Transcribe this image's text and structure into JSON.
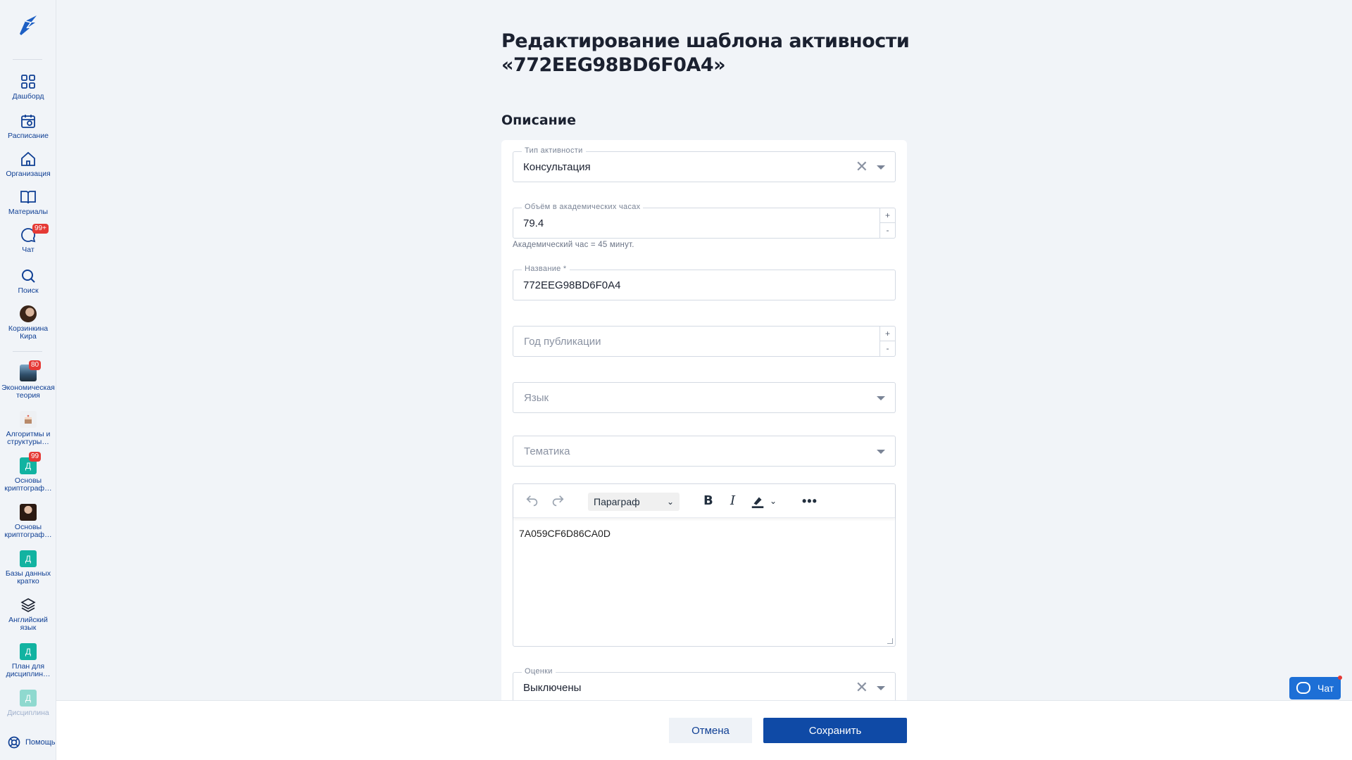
{
  "sidebar": {
    "items": [
      {
        "label": "Дашборд",
        "icon": "grid-icon"
      },
      {
        "label": "Расписание",
        "icon": "calendar-icon"
      },
      {
        "label": "Организация",
        "icon": "home-icon"
      },
      {
        "label": "Материалы",
        "icon": "book-icon"
      },
      {
        "label": "Чат",
        "icon": "chat-icon",
        "badge": "99+"
      },
      {
        "label": "Поиск",
        "icon": "search-icon"
      },
      {
        "label": "Корзинкина Кира",
        "icon": "avatar"
      }
    ],
    "courses": [
      {
        "label": "Экономическая теория",
        "badge": "80"
      },
      {
        "label": "Алгоритмы и структуры…"
      },
      {
        "label": "Основы криптограф…",
        "badge": "99",
        "initial": "Д"
      },
      {
        "label": "Основы криптограф…"
      },
      {
        "label": "Базы данных кратко",
        "initial": "Д"
      },
      {
        "label": "Английский язык"
      },
      {
        "label": "План для дисциплин…",
        "initial": "Д"
      },
      {
        "label": "Дисциплина",
        "initial": "Д"
      }
    ],
    "help_label": "Помощь"
  },
  "page": {
    "title": "Редактирование шаблона активности «772EEG98BD6F0A4»",
    "section_title": "Описание"
  },
  "form": {
    "activity_type": {
      "legend": "Тип активности",
      "value": "Консультация"
    },
    "hours": {
      "legend": "Объём в академических часах",
      "value": "79.4",
      "hint": "Академический час = 45 минут."
    },
    "name": {
      "legend": "Название *",
      "value": "772EEG98BD6F0A4"
    },
    "year": {
      "placeholder": "Год публикации"
    },
    "language": {
      "placeholder": "Язык"
    },
    "topic": {
      "placeholder": "Тематика"
    },
    "editor": {
      "block_format": "Параграф",
      "content": "7A059CF6D86CA0D"
    },
    "grades": {
      "legend": "Оценки",
      "value": "Выключены"
    },
    "spin_plus": "+",
    "spin_minus": "-"
  },
  "footer": {
    "cancel_label": "Отмена",
    "save_label": "Сохранить"
  },
  "chat_widget": {
    "label": "Чат"
  }
}
